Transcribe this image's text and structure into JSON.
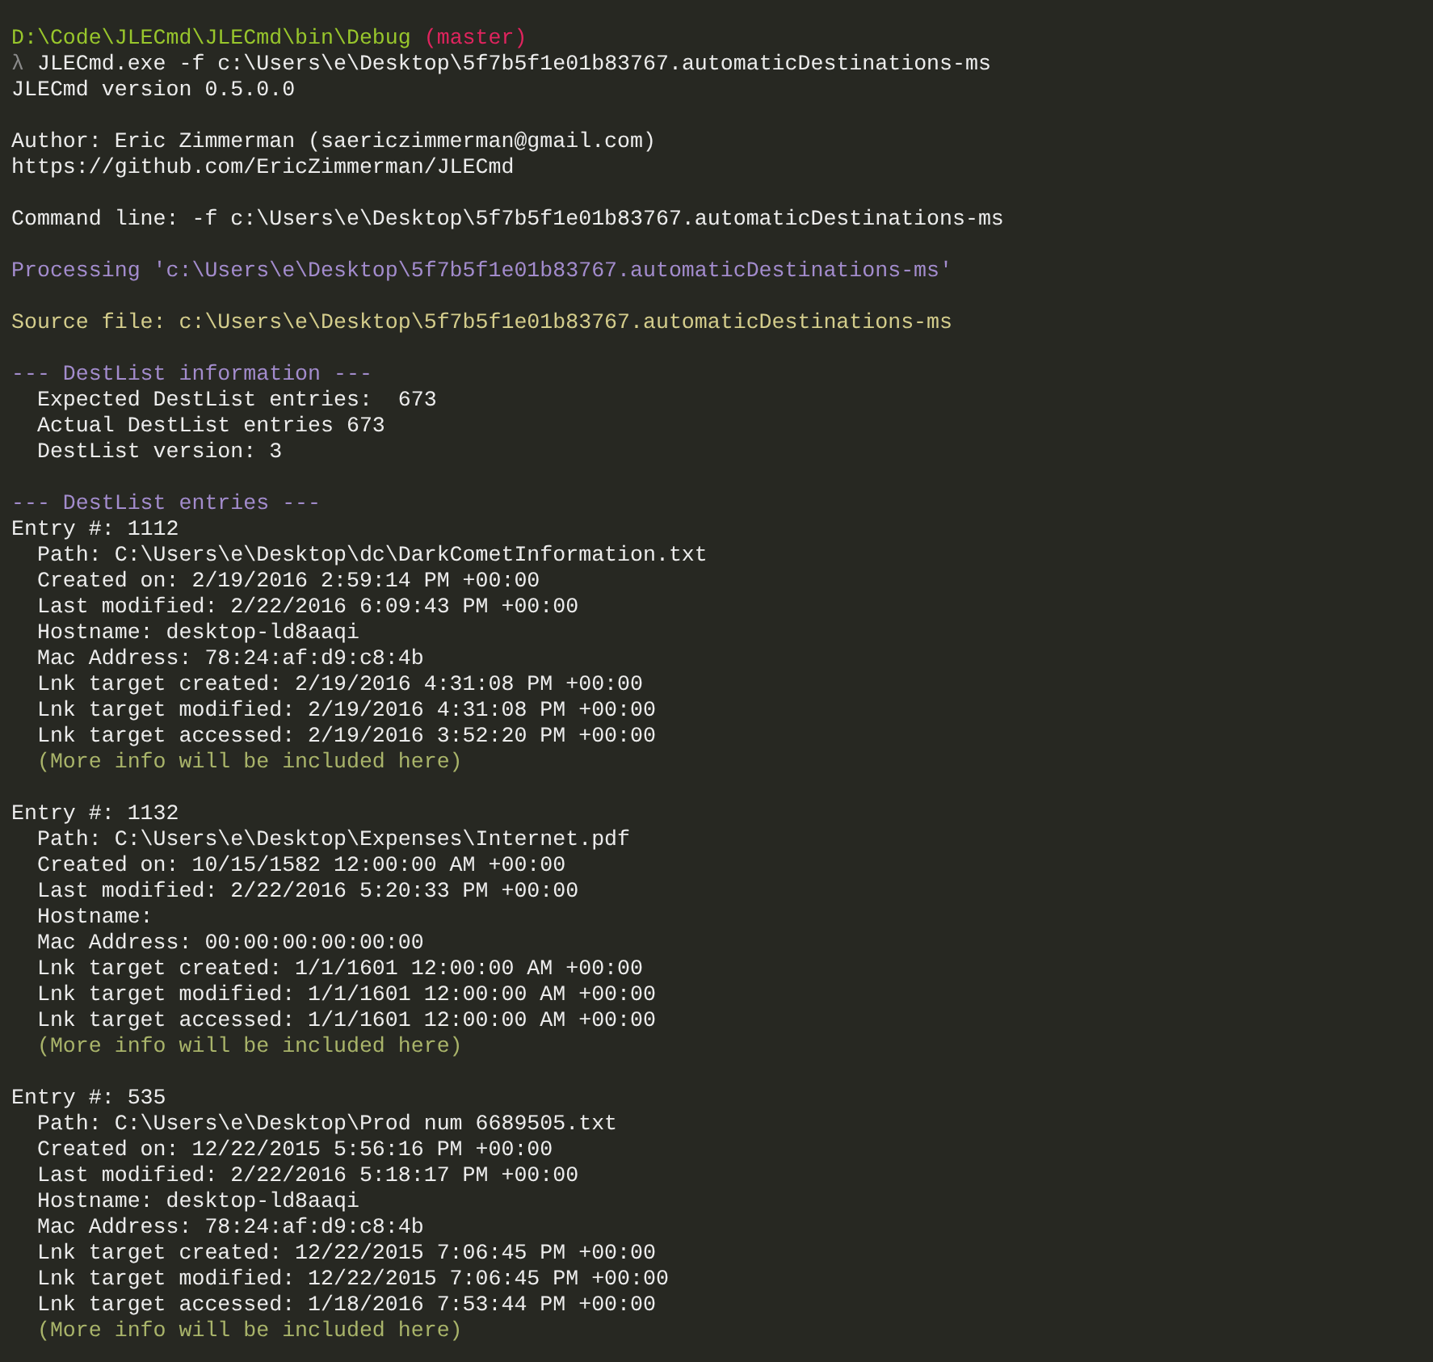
{
  "lines": [
    {
      "kind": "prompt",
      "path": "D:\\Code\\JLECmd\\JLECmd\\bin\\Debug",
      "branch": "(master)"
    },
    {
      "kind": "command",
      "symbol": "λ",
      "text": "JLECmd.exe -f c:\\Users\\e\\Desktop\\5f7b5f1e01b83767.automaticDestinations-ms"
    },
    {
      "kind": "output",
      "text": "JLECmd version 0.5.0.0"
    },
    {
      "kind": "blank"
    },
    {
      "kind": "output",
      "text": "Author: Eric Zimmerman (saericzimmerman@gmail.com)"
    },
    {
      "kind": "output",
      "text": "https://github.com/EricZimmerman/JLECmd"
    },
    {
      "kind": "blank"
    },
    {
      "kind": "output",
      "text": "Command line: -f c:\\Users\\e\\Desktop\\5f7b5f1e01b83767.automaticDestinations-ms"
    },
    {
      "kind": "blank"
    },
    {
      "kind": "highlight",
      "text": "Processing 'c:\\Users\\e\\Desktop\\5f7b5f1e01b83767.automaticDestinations-ms'"
    },
    {
      "kind": "blank"
    },
    {
      "kind": "source",
      "text": "Source file: c:\\Users\\e\\Desktop\\5f7b5f1e01b83767.automaticDestinations-ms"
    },
    {
      "kind": "blank"
    },
    {
      "kind": "highlight",
      "text": "--- DestList information ---"
    },
    {
      "kind": "output",
      "text": "  Expected DestList entries:  673"
    },
    {
      "kind": "output",
      "text": "  Actual DestList entries 673"
    },
    {
      "kind": "output",
      "text": "  DestList version: 3"
    },
    {
      "kind": "blank"
    },
    {
      "kind": "highlight",
      "text": "--- DestList entries ---"
    },
    {
      "kind": "output",
      "text": "Entry #: 1112"
    },
    {
      "kind": "output",
      "text": "  Path: C:\\Users\\e\\Desktop\\dc\\DarkCometInformation.txt"
    },
    {
      "kind": "output",
      "text": "  Created on: 2/19/2016 2:59:14 PM +00:00"
    },
    {
      "kind": "output",
      "text": "  Last modified: 2/22/2016 6:09:43 PM +00:00"
    },
    {
      "kind": "output",
      "text": "  Hostname: desktop-ld8aaqi"
    },
    {
      "kind": "output",
      "text": "  Mac Address: 78:24:af:d9:c8:4b"
    },
    {
      "kind": "output",
      "text": "  Lnk target created: 2/19/2016 4:31:08 PM +00:00"
    },
    {
      "kind": "output",
      "text": "  Lnk target modified: 2/19/2016 4:31:08 PM +00:00"
    },
    {
      "kind": "output",
      "text": "  Lnk target accessed: 2/19/2016 3:52:20 PM +00:00"
    },
    {
      "kind": "note",
      "text": "  (More info will be included here)"
    },
    {
      "kind": "blank"
    },
    {
      "kind": "output",
      "text": "Entry #: 1132"
    },
    {
      "kind": "output",
      "text": "  Path: C:\\Users\\e\\Desktop\\Expenses\\Internet.pdf"
    },
    {
      "kind": "output",
      "text": "  Created on: 10/15/1582 12:00:00 AM +00:00"
    },
    {
      "kind": "output",
      "text": "  Last modified: 2/22/2016 5:20:33 PM +00:00"
    },
    {
      "kind": "output",
      "text": "  Hostname:"
    },
    {
      "kind": "output",
      "text": "  Mac Address: 00:00:00:00:00:00"
    },
    {
      "kind": "output",
      "text": "  Lnk target created: 1/1/1601 12:00:00 AM +00:00"
    },
    {
      "kind": "output",
      "text": "  Lnk target modified: 1/1/1601 12:00:00 AM +00:00"
    },
    {
      "kind": "output",
      "text": "  Lnk target accessed: 1/1/1601 12:00:00 AM +00:00"
    },
    {
      "kind": "note",
      "text": "  (More info will be included here)"
    },
    {
      "kind": "blank"
    },
    {
      "kind": "output",
      "text": "Entry #: 535"
    },
    {
      "kind": "output",
      "text": "  Path: C:\\Users\\e\\Desktop\\Prod num 6689505.txt"
    },
    {
      "kind": "output",
      "text": "  Created on: 12/22/2015 5:56:16 PM +00:00"
    },
    {
      "kind": "output",
      "text": "  Last modified: 2/22/2016 5:18:17 PM +00:00"
    },
    {
      "kind": "output",
      "text": "  Hostname: desktop-ld8aaqi"
    },
    {
      "kind": "output",
      "text": "  Mac Address: 78:24:af:d9:c8:4b"
    },
    {
      "kind": "output",
      "text": "  Lnk target created: 12/22/2015 7:06:45 PM +00:00"
    },
    {
      "kind": "output",
      "text": "  Lnk target modified: 12/22/2015 7:06:45 PM +00:00"
    },
    {
      "kind": "output",
      "text": "  Lnk target accessed: 1/18/2016 7:53:44 PM +00:00"
    },
    {
      "kind": "note",
      "text": "  (More info will be included here)"
    }
  ]
}
